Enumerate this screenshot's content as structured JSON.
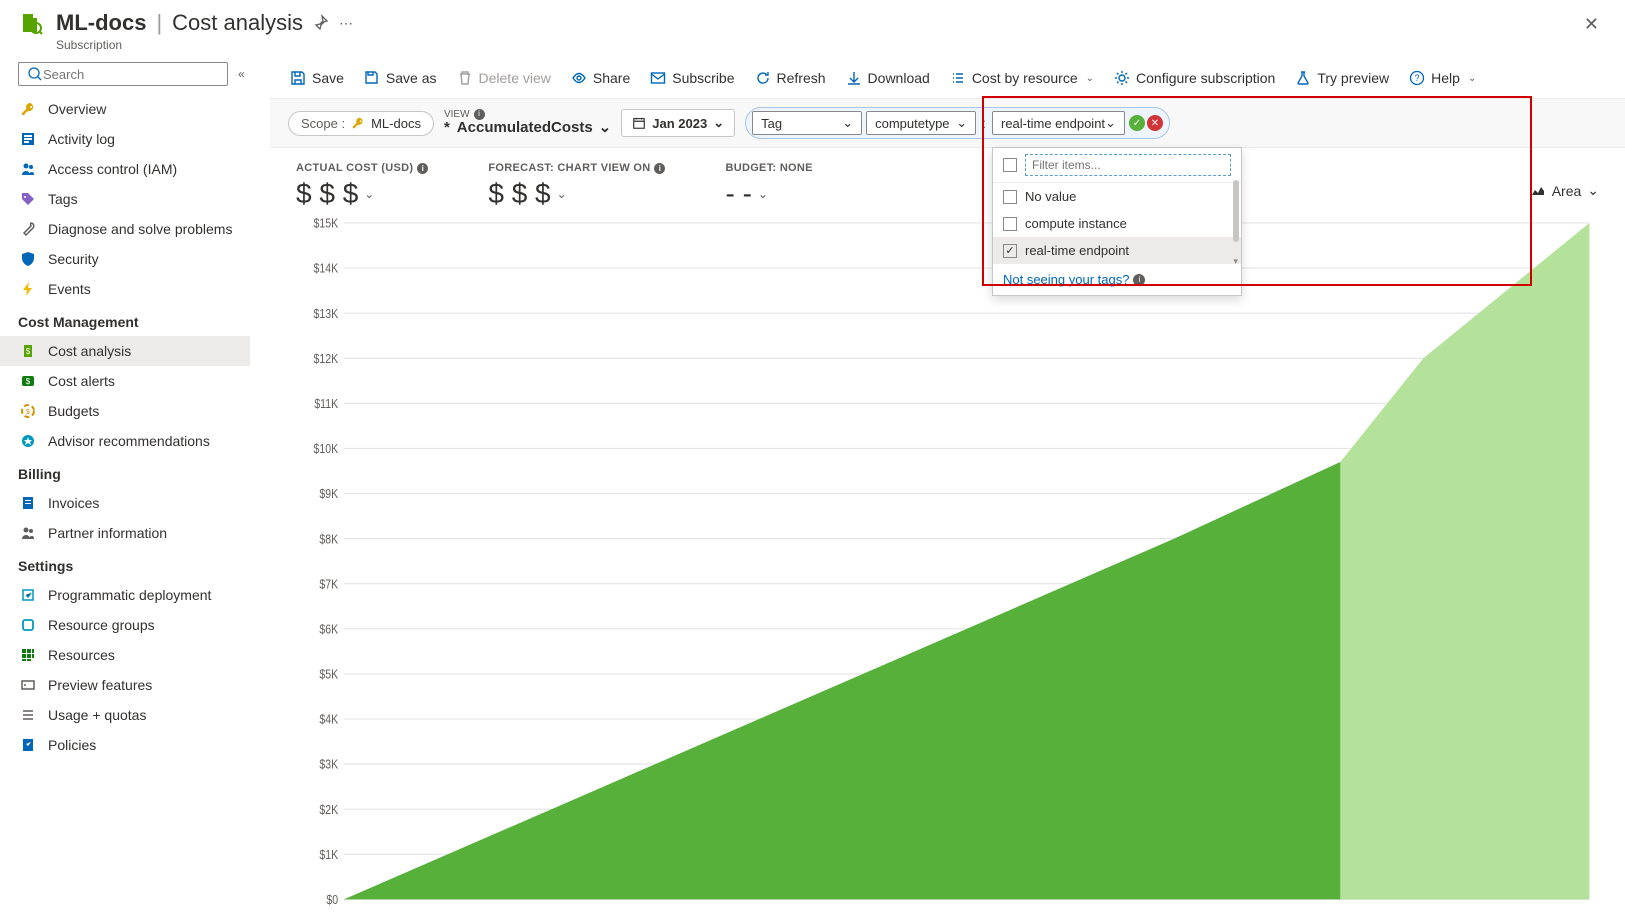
{
  "header": {
    "title_main": "ML-docs",
    "title_separator": "|",
    "title_page": "Cost analysis",
    "subtitle": "Subscription",
    "close_icon": "✕"
  },
  "search": {
    "placeholder": "Search"
  },
  "sidebar": {
    "items_top": [
      {
        "label": "Overview",
        "icon": "key",
        "color": "#dba704"
      },
      {
        "label": "Activity log",
        "icon": "log",
        "color": "#0067b8"
      },
      {
        "label": "Access control (IAM)",
        "icon": "people",
        "color": "#0067b8"
      },
      {
        "label": "Tags",
        "icon": "tag",
        "color": "#8661c5"
      },
      {
        "label": "Diagnose and solve problems",
        "icon": "wrench",
        "color": "#605e5c"
      },
      {
        "label": "Security",
        "icon": "shield",
        "color": "#0067b8"
      },
      {
        "label": "Events",
        "icon": "bolt",
        "color": "#f2b900"
      }
    ],
    "section_cost": "Cost Management",
    "items_cost": [
      {
        "label": "Cost analysis",
        "icon": "cost",
        "color": "#57a300",
        "selected": true
      },
      {
        "label": "Cost alerts",
        "icon": "alert",
        "color": "#107c10"
      },
      {
        "label": "Budgets",
        "icon": "budget",
        "color": "#d29200"
      },
      {
        "label": "Advisor recommendations",
        "icon": "advisor",
        "color": "#0099bc"
      }
    ],
    "section_billing": "Billing",
    "items_billing": [
      {
        "label": "Invoices",
        "icon": "invoice",
        "color": "#0067b8"
      },
      {
        "label": "Partner information",
        "icon": "people",
        "color": "#605e5c"
      }
    ],
    "section_settings": "Settings",
    "items_settings": [
      {
        "label": "Programmatic deployment",
        "icon": "deploy",
        "color": "#0099bc"
      },
      {
        "label": "Resource groups",
        "icon": "rg",
        "color": "#0099bc"
      },
      {
        "label": "Resources",
        "icon": "grid",
        "color": "#107c10"
      },
      {
        "label": "Preview features",
        "icon": "preview",
        "color": "#605e5c"
      },
      {
        "label": "Usage + quotas",
        "icon": "usage",
        "color": "#605e5c"
      },
      {
        "label": "Policies",
        "icon": "policy",
        "color": "#0067b8"
      }
    ]
  },
  "toolbar": {
    "save": "Save",
    "save_as": "Save as",
    "delete_view": "Delete view",
    "share": "Share",
    "subscribe": "Subscribe",
    "refresh": "Refresh",
    "download": "Download",
    "cost_by_resource": "Cost by resource",
    "configure": "Configure subscription",
    "try_preview": "Try preview",
    "help": "Help"
  },
  "filterbar": {
    "scope_label": "Scope :",
    "scope_value": "ML-docs",
    "view_label": "VIEW",
    "view_value_prefix": "*",
    "view_value": "AccumulatedCosts",
    "date_value": "Jan 2023",
    "filter": {
      "dim1": "Tag",
      "dim2": "computetype",
      "value": "real-time endpoint"
    },
    "dropdown": {
      "filter_placeholder": "Filter items...",
      "options": [
        {
          "label": "No value",
          "checked": false
        },
        {
          "label": "compute instance",
          "checked": false
        },
        {
          "label": "real-time endpoint",
          "checked": true
        }
      ],
      "link": "Not seeing your tags?"
    }
  },
  "kpis": {
    "actual_label": "ACTUAL COST (USD)",
    "actual_value": "$ $ $",
    "forecast_label": "FORECAST: CHART VIEW ON",
    "forecast_value": "$ $ $",
    "budget_label": "BUDGET: NONE",
    "budget_value": "- -"
  },
  "chart_type": "Area",
  "chart_data": {
    "type": "area",
    "title": "",
    "xlabel": "",
    "ylabel": "",
    "ylim": [
      0,
      15000
    ],
    "y_ticks": [
      "$0",
      "$1K",
      "$2K",
      "$3K",
      "$4K",
      "$5K",
      "$6K",
      "$7K",
      "$8K",
      "$9K",
      "$10K",
      "$11K",
      "$12K",
      "$13K",
      "$14K",
      "$15K"
    ],
    "series": [
      {
        "name": "actual",
        "color": "#56b03a",
        "x": [
          1,
          6,
          11,
          16,
          21,
          25
        ],
        "values": [
          0,
          2000,
          4000,
          6000,
          8000,
          9700
        ]
      },
      {
        "name": "forecast",
        "color": "#b4e29b",
        "x": [
          25,
          27,
          29,
          31
        ],
        "values": [
          9700,
          12000,
          13500,
          15000
        ]
      }
    ]
  }
}
